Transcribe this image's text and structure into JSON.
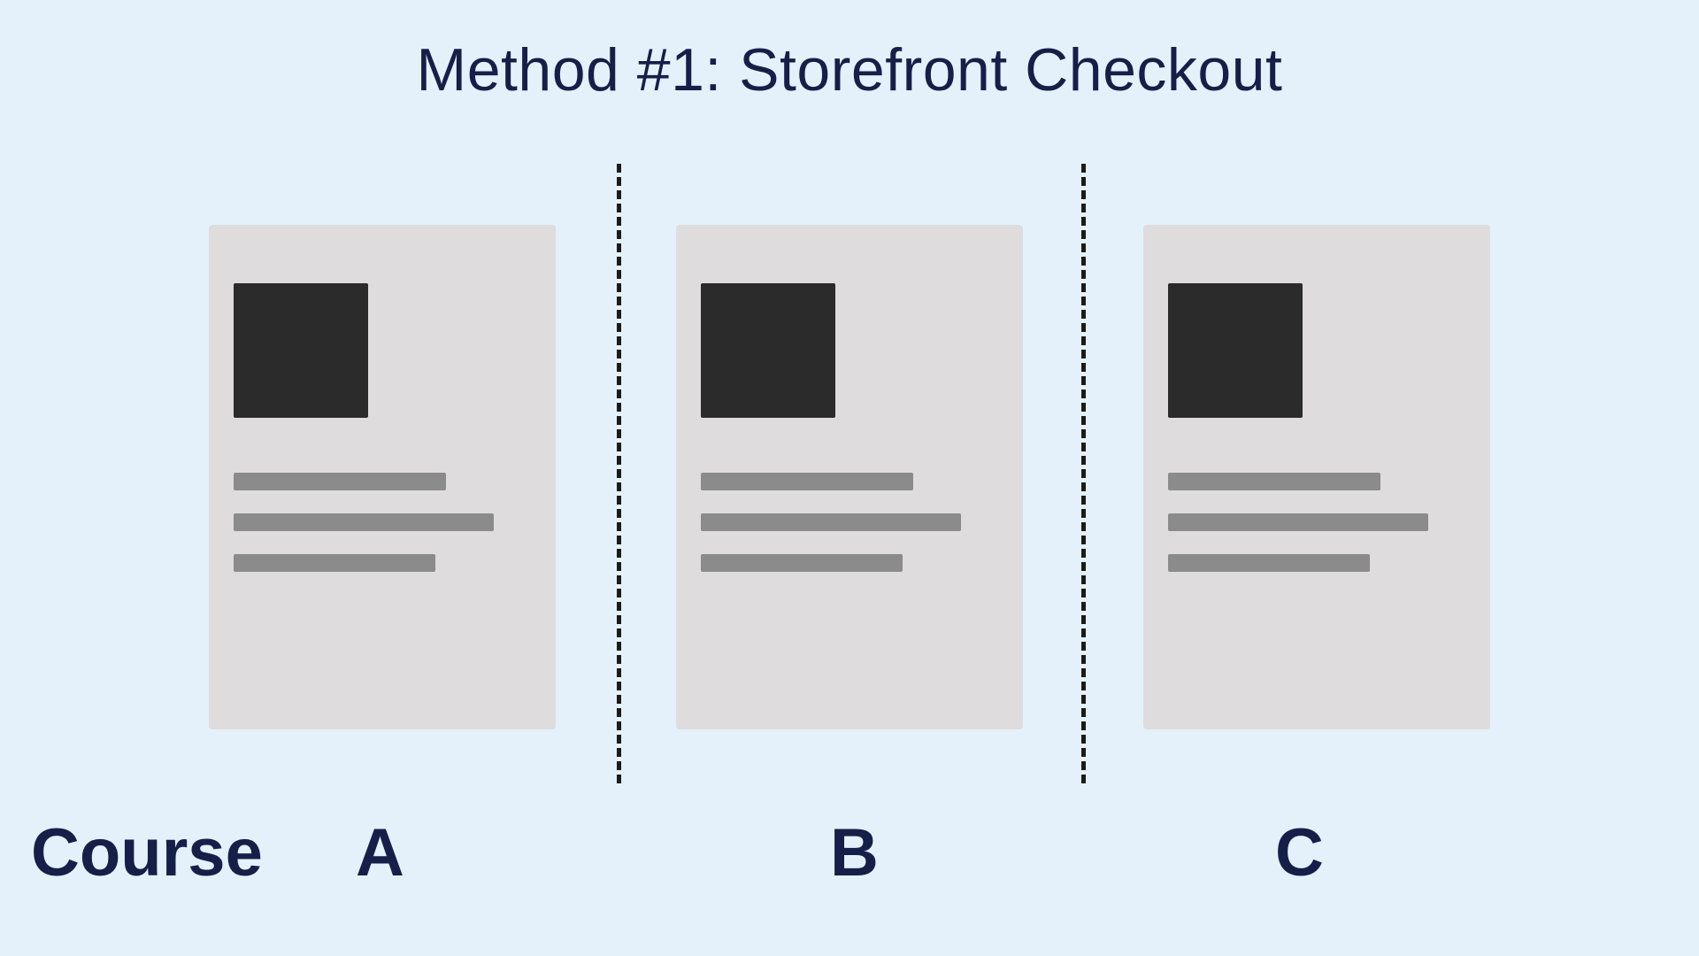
{
  "title": "Method #1: Storefront Checkout",
  "labels": {
    "course": "Course",
    "a": "A",
    "b": "B",
    "c": "C"
  },
  "cards": [
    {
      "id": "A"
    },
    {
      "id": "B"
    },
    {
      "id": "C"
    }
  ]
}
